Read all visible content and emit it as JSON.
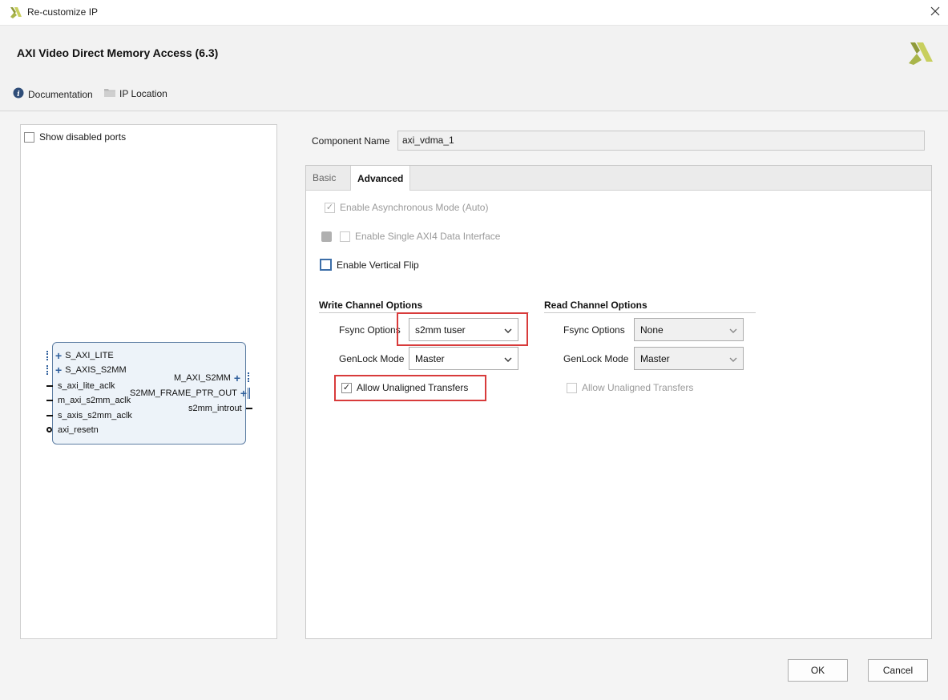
{
  "window": {
    "title": "Re-customize IP"
  },
  "header": {
    "ip_title": "AXI Video Direct Memory Access (6.3)",
    "doc_label": "Documentation",
    "location_label": "IP Location"
  },
  "left_panel": {
    "show_disabled_label": "Show disabled ports",
    "block": {
      "left_ports": [
        "S_AXI_LITE",
        "S_AXIS_S2MM",
        "s_axi_lite_aclk",
        "m_axi_s2mm_aclk",
        "s_axis_s2mm_aclk",
        "axi_resetn"
      ],
      "right_ports": [
        "M_AXI_S2MM",
        "S2MM_FRAME_PTR_OUT",
        "s2mm_introut"
      ]
    }
  },
  "component": {
    "label": "Component Name",
    "value": "axi_vdma_1"
  },
  "tabs": [
    {
      "label": "Basic"
    },
    {
      "label": "Advanced"
    }
  ],
  "advanced": {
    "async_label": "Enable Asynchronous Mode (Auto)",
    "single_axi_label": "Enable Single AXI4 Data Interface",
    "vflip_label": "Enable Vertical Flip",
    "write": {
      "title": "Write Channel Options",
      "fsync_label": "Fsync Options",
      "fsync_value": "s2mm tuser",
      "genlock_label": "GenLock Mode",
      "genlock_value": "Master",
      "unaligned_label": "Allow Unaligned Transfers"
    },
    "read": {
      "title": "Read Channel Options",
      "fsync_label": "Fsync Options",
      "fsync_value": "None",
      "genlock_label": "GenLock Mode",
      "genlock_value": "Master",
      "unaligned_label": "Allow Unaligned Transfers"
    }
  },
  "buttons": {
    "ok": "OK",
    "cancel": "Cancel"
  },
  "colors": {
    "highlight": "#d83b3b",
    "logo": "#a9b54a",
    "accent_blue": "#2f5f9c"
  }
}
